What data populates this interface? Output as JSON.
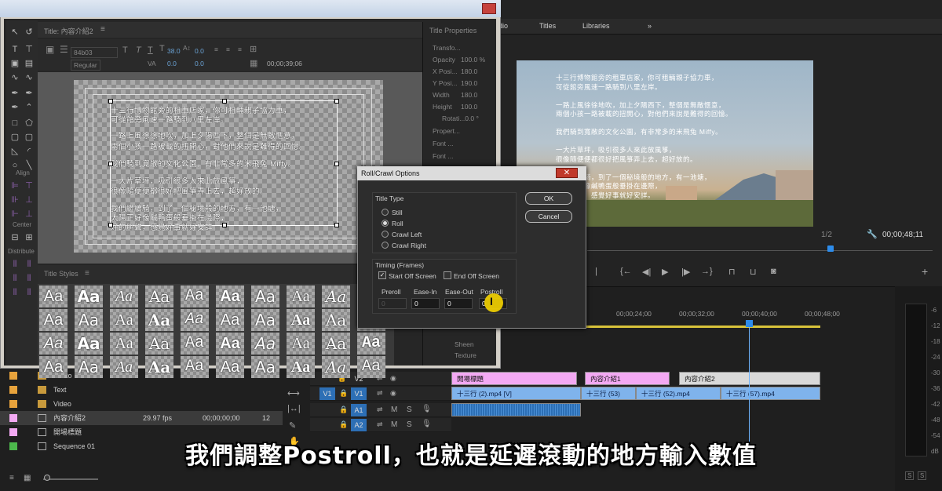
{
  "program_tabs": {
    "audio": "udio",
    "titles": "Titles",
    "libraries": "Libraries",
    "more": "»"
  },
  "program": {
    "video_lines": [
      "十三行博物館旁的租車店家，你可租輛親子協力車，",
      "可從館旁風速一路騎到八里左岸。",
      "",
      "一路上風徐徐地吹，加上夕陽西下，整個是無敵愜意，",
      "兩個小孩一路被載的扭開心，對他們來說是難得的回憶。",
      "",
      "我們騎到寬敞的文化公園，有非常多的米飛兔 Miffy。",
      "",
      "一大片草坪，吸引很多人來此放風箏，",
      "很像隨便便都很好把風箏弄上去，超好放的。",
      "",
      "我們繼續騎，到了一個秘境般的地方，有一池塘，",
      "太陽正好像鹹鴨蛋般垂掛在邊際，",
      "好的叫聲，感覺好事就好安詳。"
    ],
    "zoom": "1/2",
    "timecode": "00;00;48;11"
  },
  "timeline": {
    "ruler": [
      "00;00;24;00",
      "00;00;32;00",
      "00;00;40;00",
      "00;00;48;00"
    ],
    "tracks": {
      "v2": "V2",
      "v1_src": "V1",
      "v1": "V1",
      "a1": "A1",
      "a2": "A2"
    },
    "clips_v2": [
      "開場標題",
      "內容介紹1",
      "內容介紹2"
    ],
    "clips_v1": [
      "十三行 (2).mp4 [V]",
      "十三行 (53)",
      "十三行 (52).mp4",
      "十三行 (57).mp4"
    ],
    "track_ms": [
      "M",
      "S"
    ]
  },
  "meter_labels": [
    "-6",
    "-12",
    "-18",
    "-24",
    "-30",
    "-36",
    "-42",
    "-48",
    "-54",
    "dB"
  ],
  "meter_ss": [
    "S",
    "S"
  ],
  "project": {
    "rows": [
      {
        "name": "Photo",
        "fps": "",
        "start": "",
        "extra": ""
      },
      {
        "name": "Text",
        "fps": "",
        "start": "",
        "extra": ""
      },
      {
        "name": "Video",
        "fps": "",
        "start": "",
        "extra": ""
      },
      {
        "name": "內容介紹2",
        "fps": "29.97 fps",
        "start": "00;00;00;00",
        "extra": "12"
      },
      {
        "name": "開場標題",
        "fps": "",
        "start": "",
        "extra": ""
      },
      {
        "name": "Sequence 01",
        "fps": "",
        "start": "",
        "extra": ""
      }
    ],
    "row_colors": [
      "#e8a33c",
      "#e8a33c",
      "#e8a33c",
      "#f3a9f3",
      "#f3a9f3",
      "#4cb84c"
    ]
  },
  "title_window": {
    "title_tab": "Title: 內容介紹2",
    "menu_icon": "≡",
    "font": "84b03",
    "style": "Regular",
    "font_size": "38.0",
    "kerning": "0.0",
    "leading": "0.0",
    "tracking": "0.0",
    "timecode": "00;00;39;06",
    "properties_title": "Title Properties",
    "props": [
      "Transfo...",
      "Opacity",
      "100.0 %",
      "X Posi...",
      "180.0",
      "Y Posi...",
      "190.0",
      "Width",
      "180.0",
      "Height",
      "100.0",
      "Rotati...0.0 °",
      "Propert...",
      "Font ...",
      "Font ...",
      "Sheen",
      "Texture"
    ],
    "text_lines": [
      "十三行博物館旁的租車店家，你可租輛親子協力車，",
      "可從館旁風速一路騎到八里左岸。",
      "一路上風徐徐地吹，加上夕陽西下，整個是無敵愜意，",
      "兩個小孩一路被載的扭開心，對他們來說是難得的回憶。",
      "我們騎到寬敞的文化公園，有非常多的米飛兔 Miffy。",
      "一大片草坪，吸引很多人來此放風箏，",
      "很像隨便便都很好把風箏弄上去，超好放的。",
      "我們繼續騎，到了一個秘境般的地方，有一池塘，",
      "太陽正好像鹹鴨蛋般垂掛在邊際，",
      "好的叫聲，感覺好事就好安詳。"
    ],
    "side_labels": {
      "align": "Align",
      "center": "Center",
      "distribute": "Distribute"
    },
    "styles_title": "Title Styles",
    "style_sample": "Aa"
  },
  "dialog": {
    "title": "Roll/Crawl Options",
    "close": "✕",
    "title_type_label": "Title Type",
    "options": [
      "Still",
      "Roll",
      "Crawl Left",
      "Crawl Right"
    ],
    "selected": "Roll",
    "ok": "OK",
    "cancel": "Cancel",
    "timing_label": "Timing (Frames)",
    "start_off": "Start Off Screen",
    "end_off": "End Off Screen",
    "start_checked": true,
    "end_checked": false,
    "preroll_label": "Preroll",
    "easein_label": "Ease-In",
    "easeout_label": "Ease-Out",
    "postroll_label": "Postroll",
    "preroll": "0",
    "easein": "0",
    "easeout": "0",
    "postroll": "0"
  },
  "subtitle": "我們調整Postroll，也就是延遲滾動的地方輸入數值"
}
